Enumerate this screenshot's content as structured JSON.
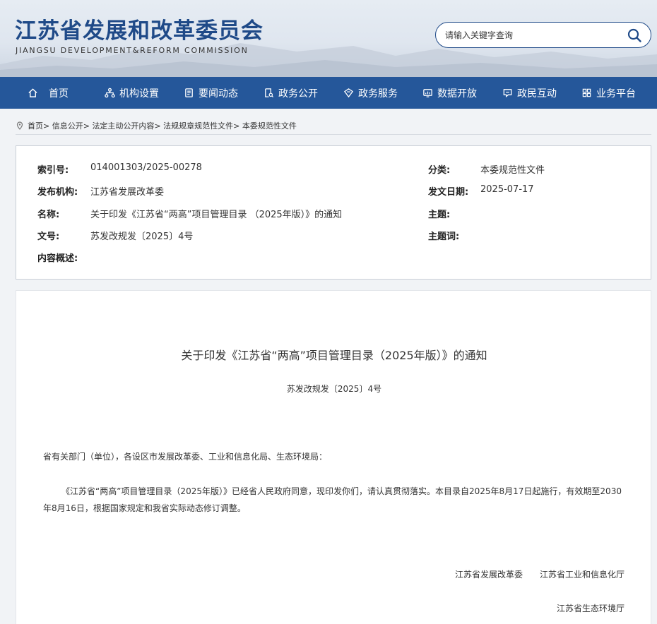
{
  "header": {
    "title": "江苏省发展和改革委员会",
    "subtitle": "JIANGSU DEVELOPMENT&REFORM COMMISSION",
    "search_placeholder": "请输入关键字查询"
  },
  "nav": [
    {
      "label": "首页",
      "icon": "home-icon"
    },
    {
      "label": "机构设置",
      "icon": "org-chart-icon"
    },
    {
      "label": "要闻动态",
      "icon": "news-icon"
    },
    {
      "label": "政务公开",
      "icon": "document-search-icon"
    },
    {
      "label": "政务服务",
      "icon": "service-icon"
    },
    {
      "label": "数据开放",
      "icon": "monitor-chart-icon"
    },
    {
      "label": "政民互动",
      "icon": "chat-icon"
    },
    {
      "label": "业务平台",
      "icon": "grid-icon"
    }
  ],
  "breadcrumb": [
    "首页",
    "信息公开",
    "法定主动公开内容",
    "法规规章规范性文件",
    "本委规范性文件"
  ],
  "breadcrumb_separator": ">",
  "meta": {
    "index_label": "索引号:",
    "index_value": "014001303/2025-00278",
    "category_label": "分类:",
    "category_value": "本委规范性文件",
    "publisher_label": "发布机构:",
    "publisher_value": "江苏省发展改革委",
    "date_label": "发文日期:",
    "date_value": "2025-07-17",
    "name_label": "名称:",
    "name_value": "关于印发《江苏省“两高”项目管理目录 （2025年版）》的通知",
    "subject_label": "主题:",
    "subject_value": "",
    "docno_label": "文号:",
    "docno_value": "苏发改规发〔2025〕4号",
    "keywords_label": "主题词:",
    "keywords_value": "",
    "summary_label": "内容概述:",
    "summary_value": ""
  },
  "article": {
    "title": "关于印发《江苏省“两高”项目管理目录（2025年版）》的通知",
    "doc_number": "苏发改规发〔2025〕4号",
    "salutation": "省有关部门（单位），各设区市发展改革委、工业和信息化局、生态环境局：",
    "body": "《江苏省“两高”项目管理目录（2025年版）》已经省人民政府同意，现印发你们，请认真贯彻落实。本目录自2025年8月17日起施行，有效期至2030年8月16日，根据国家规定和我省实际动态修订调整。",
    "signatories": [
      "江苏省发展改革委",
      "江苏省工业和信息化厅",
      "江苏省生态环境厅"
    ]
  },
  "colors": {
    "brand": "#1f4a88",
    "nav_bg": "#25579a"
  }
}
